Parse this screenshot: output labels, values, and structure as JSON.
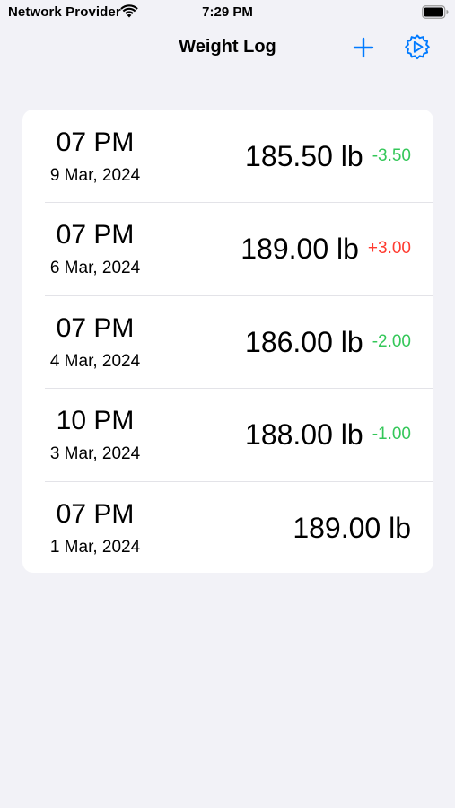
{
  "status_bar": {
    "carrier": "Network Provider",
    "time": "7:29 PM",
    "wifi_icon": "wifi-icon",
    "battery_icon": "battery-icon"
  },
  "nav": {
    "title": "Weight Log",
    "add_icon": "plus-icon",
    "settings_icon": "settings-gear-icon"
  },
  "colors": {
    "accent": "#007aff",
    "decrease": "#34c759",
    "increase": "#ff3b30",
    "background": "#f2f2f7"
  },
  "entries": [
    {
      "time": "07 PM",
      "date": "9 Mar, 2024",
      "weight": "185.50 lb",
      "change": "-3.50",
      "direction": "down"
    },
    {
      "time": "07 PM",
      "date": "6 Mar, 2024",
      "weight": "189.00 lb",
      "change": "+3.00",
      "direction": "up"
    },
    {
      "time": "07 PM",
      "date": "4 Mar, 2024",
      "weight": "186.00 lb",
      "change": "-2.00",
      "direction": "down"
    },
    {
      "time": "10 PM",
      "date": "3 Mar, 2024",
      "weight": "188.00 lb",
      "change": "-1.00",
      "direction": "down"
    },
    {
      "time": "07 PM",
      "date": "1 Mar, 2024",
      "weight": "189.00 lb",
      "change": "",
      "direction": "none"
    }
  ]
}
